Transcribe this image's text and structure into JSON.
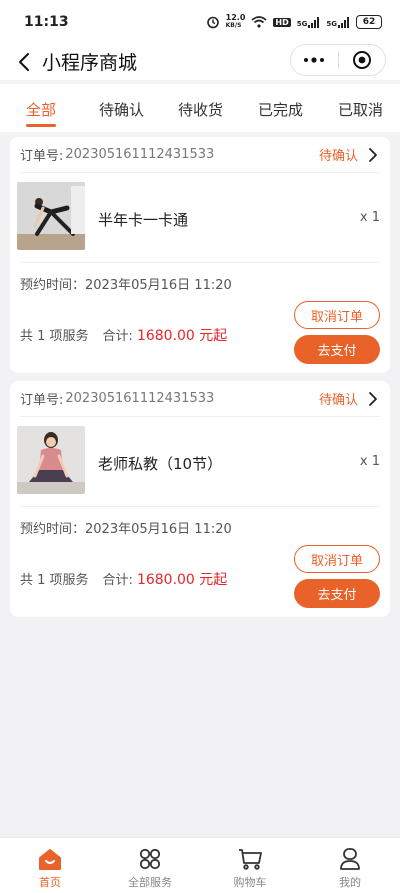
{
  "status_bar": {
    "time": "11:13",
    "speed": "12.0",
    "speed_unit": "KB/S",
    "hd": "HD",
    "net1": "5G",
    "net2": "5G",
    "battery": "62"
  },
  "nav": {
    "title": "小程序商城"
  },
  "tabs": [
    {
      "label": "全部",
      "active": true
    },
    {
      "label": "待确认"
    },
    {
      "label": "待收货"
    },
    {
      "label": "已完成"
    },
    {
      "label": "已取消"
    }
  ],
  "orders": [
    {
      "order_no_label": "订单号:",
      "order_no": "2023051611124315​33",
      "status": "待确认",
      "product_name": "半年卡一卡通",
      "qty": "x 1",
      "booking_time": "预约时间：2023年05月16日 11:20",
      "count_text": "共 1 项服务",
      "total_label": "合计:",
      "amount": "1680.00 元起",
      "cancel_label": "取消订单",
      "pay_label": "去支付"
    },
    {
      "order_no_label": "订单号:",
      "order_no": "2023051611124315​33",
      "status": "待确认",
      "product_name": "老师私教（10节）",
      "qty": "x 1",
      "booking_time": "预约时间：2023年05月16日 11:20",
      "count_text": "共 1 项服务",
      "total_label": "合计:",
      "amount": "1680.00 元起",
      "cancel_label": "取消订单",
      "pay_label": "去支付"
    }
  ],
  "tabbar": [
    {
      "label": "首页",
      "icon": "home-icon",
      "active": true
    },
    {
      "label": "全部服务",
      "icon": "grid-icon"
    },
    {
      "label": "购物车",
      "icon": "cart-icon"
    },
    {
      "label": "我的",
      "icon": "user-icon"
    }
  ],
  "colors": {
    "accent": "#e8622a",
    "price": "#e8262a"
  }
}
